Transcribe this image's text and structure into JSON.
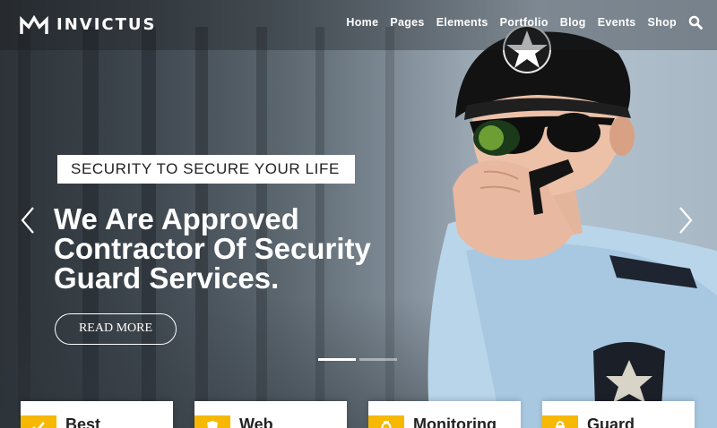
{
  "brand": {
    "name": "INVICTUS"
  },
  "nav": {
    "items": [
      "Home",
      "Pages",
      "Elements",
      "Portfolio",
      "Blog",
      "Events",
      "Shop"
    ],
    "search_icon": "search-icon"
  },
  "slide": {
    "tagline": "SECURITY TO SECURE YOUR LIFE",
    "headline_lines": [
      "We Are Approved",
      "Contractor Of Security",
      "Guard Services."
    ],
    "cta": "READ MORE",
    "active_slide": 1,
    "slide_count": 2
  },
  "cards": [
    {
      "title": "Best"
    },
    {
      "title": "Web"
    },
    {
      "title": "Monitoring"
    },
    {
      "title": "Guard"
    }
  ],
  "colors": {
    "accent": "#f6b800",
    "white": "#ffffff"
  }
}
